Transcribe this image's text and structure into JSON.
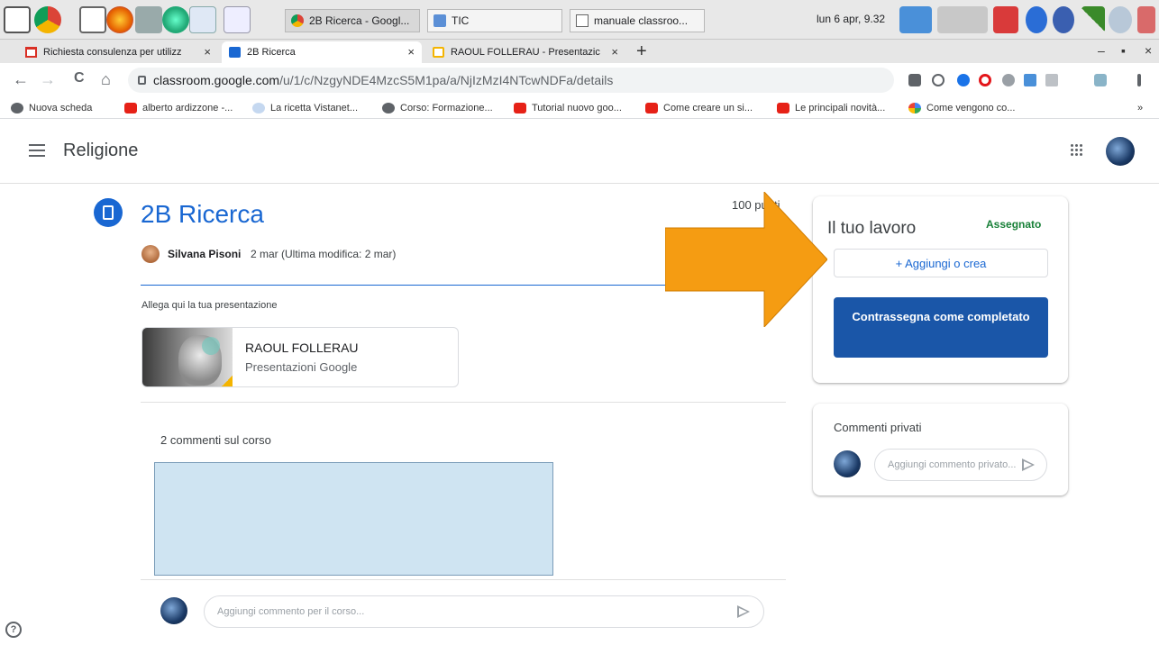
{
  "taskbar": {
    "tasks": [
      {
        "label": "2B Ricerca - Googl..."
      },
      {
        "label": "TIC"
      },
      {
        "label": "manuale classroo..."
      }
    ],
    "clock": "lun 6 apr, 9.32"
  },
  "browser": {
    "tabs": [
      {
        "label": "Richiesta consulenza per utilizz",
        "close": "×"
      },
      {
        "label": "2B Ricerca",
        "close": "×"
      },
      {
        "label": "RAOUL FOLLERAU - Presentazic",
        "close": "×"
      }
    ],
    "new_tab": "+",
    "window_controls": {
      "minimize": "–",
      "maximize": "▪",
      "close": "×"
    },
    "nav": {
      "back": "←",
      "forward": "→",
      "reload": "C",
      "home": "⌂"
    },
    "address": {
      "domain": "classroom.google.com",
      "path": "/u/1/c/NzgyNDE4MzcS5M1pa/a/NjIzMzI4NTcwNDFa/details"
    },
    "bookmarks": [
      {
        "label": "Nuova scheda"
      },
      {
        "label": "alberto ardizzone -..."
      },
      {
        "label": "La ricetta Vistanet..."
      },
      {
        "label": "Corso: Formazione..."
      },
      {
        "label": "Tutorial nuovo goo..."
      },
      {
        "label": "Come creare un si..."
      },
      {
        "label": "Le principali novità..."
      },
      {
        "label": "Come vengono co..."
      }
    ],
    "bookmarks_more": "»"
  },
  "app": {
    "class_name": "Religione"
  },
  "assignment": {
    "title": "2B Ricerca",
    "points": "100 punti",
    "author": "Silvana Pisoni",
    "date": "2 mar (Ultima modifica: 2 mar)",
    "instructions": "Allega qui la tua presentazione",
    "attachment": {
      "name": "RAOUL FOLLERAU",
      "type": "Presentazioni Google"
    },
    "class_comments_count": "2 commenti sul corso",
    "class_comment_placeholder": "Aggiungi commento per il corso..."
  },
  "your_work": {
    "title": "Il tuo lavoro",
    "status": "Assegnato",
    "add_label": "+ Aggiungi o crea",
    "mark_done_label": "Contrassegna come completato"
  },
  "private_comments": {
    "title": "Commenti privati",
    "placeholder": "Aggiungi commento privato..."
  },
  "help_label": "?",
  "colors": {
    "accent": "#1967d2",
    "status": "#188038",
    "button": "#1a56a8",
    "arrow": "#f59c12"
  }
}
